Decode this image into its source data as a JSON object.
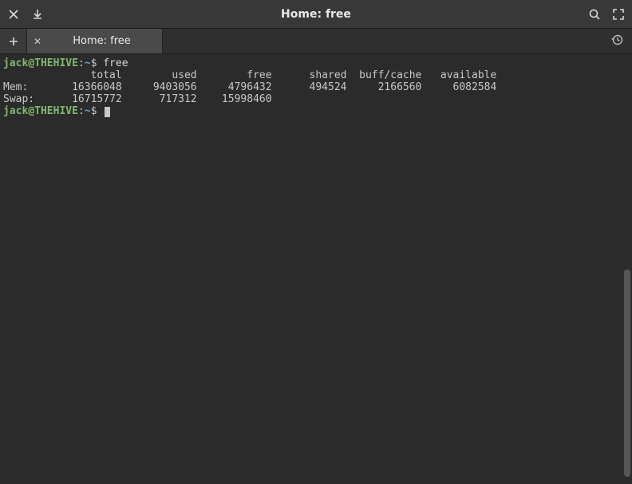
{
  "window": {
    "title": "Home: free"
  },
  "tabs": [
    {
      "label": "Home: free"
    }
  ],
  "prompt": {
    "user": "jack@THEHIVE",
    "sep": ":",
    "path": "~",
    "dollar": "$"
  },
  "session": {
    "command": "free",
    "output": {
      "header": "              total        used        free      shared  buff/cache   available",
      "mem": "Mem:       16366048     9403056     4796432      494524     2166560     6082584",
      "swap": "Swap:      16715772      717312    15998460"
    }
  },
  "icons": {
    "close": "✕",
    "download": "↧",
    "search": "search",
    "expand": "expand",
    "plus": "+",
    "history": "history"
  }
}
